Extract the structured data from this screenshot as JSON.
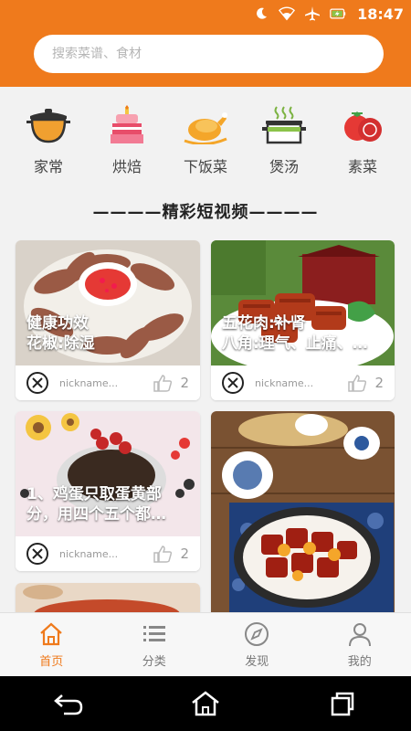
{
  "status_bar": {
    "time": "18:47"
  },
  "search": {
    "placeholder": "搜索菜谱、食材"
  },
  "categories": [
    {
      "label": "家常",
      "icon": "pot-icon"
    },
    {
      "label": "烘焙",
      "icon": "cake-icon"
    },
    {
      "label": "下饭菜",
      "icon": "roast-chicken-icon"
    },
    {
      "label": "煲汤",
      "icon": "soup-pot-icon"
    },
    {
      "label": "素菜",
      "icon": "tomato-icon"
    }
  ],
  "section_title": "————精彩短视频————",
  "cards": [
    {
      "text": "健康功效\n花椒:除湿",
      "nickname": "nickname...",
      "likes": "2"
    },
    {
      "text": "五花肉:补肾\n八角:理气、止痛、…",
      "nickname": "nickname...",
      "likes": "2"
    },
    {
      "text": "1、鸡蛋只取蛋黄部\n分，用四个五个都…",
      "nickname": "nickname...",
      "likes": "2"
    }
  ],
  "tabs": [
    {
      "label": "首页",
      "icon": "home-icon",
      "active": true
    },
    {
      "label": "分类",
      "icon": "list-icon"
    },
    {
      "label": "发现",
      "icon": "compass-icon"
    },
    {
      "label": "我的",
      "icon": "user-icon"
    }
  ],
  "colors": {
    "accent": "#ef7a1c",
    "background": "#f2f2f2"
  }
}
